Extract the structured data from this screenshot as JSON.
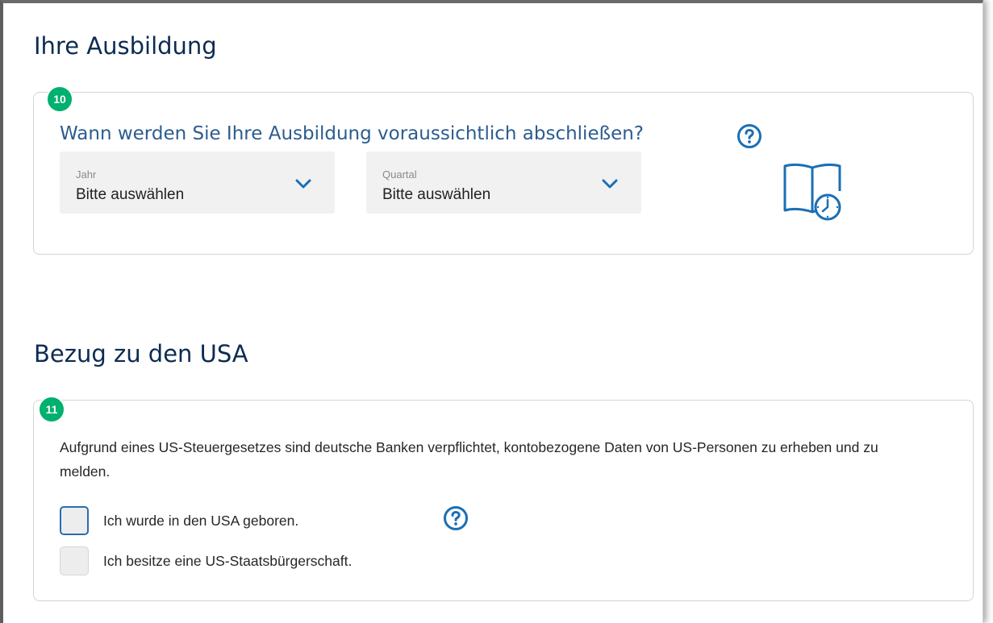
{
  "education": {
    "title": "Ihre Ausbildung",
    "step": "10",
    "question": "Wann werden Sie Ihre Ausbildung voraussichtlich abschließen?",
    "year_select": {
      "label": "Jahr",
      "value": "Bitte auswählen"
    },
    "quarter_select": {
      "label": "Quartal",
      "value": "Bitte auswählen"
    },
    "illustration_icon": "book-clock-icon"
  },
  "usa": {
    "title": "Bezug zu den USA",
    "step": "11",
    "info_text": "Aufgrund eines US-Steuergesetzes sind deutsche Banken verpflichtet, kontobezogene Daten von US-Personen zu erheben und zu melden.",
    "checkboxes": [
      {
        "label": "Ich wurde in den USA geboren.",
        "checked": false
      },
      {
        "label": "Ich besitze eine US-Staatsbürgerschaft.",
        "checked": false
      }
    ]
  },
  "colors": {
    "badge": "#00b06e",
    "heading": "#0c2b52",
    "question": "#2c5c8f",
    "accent": "#1a6fb5"
  }
}
